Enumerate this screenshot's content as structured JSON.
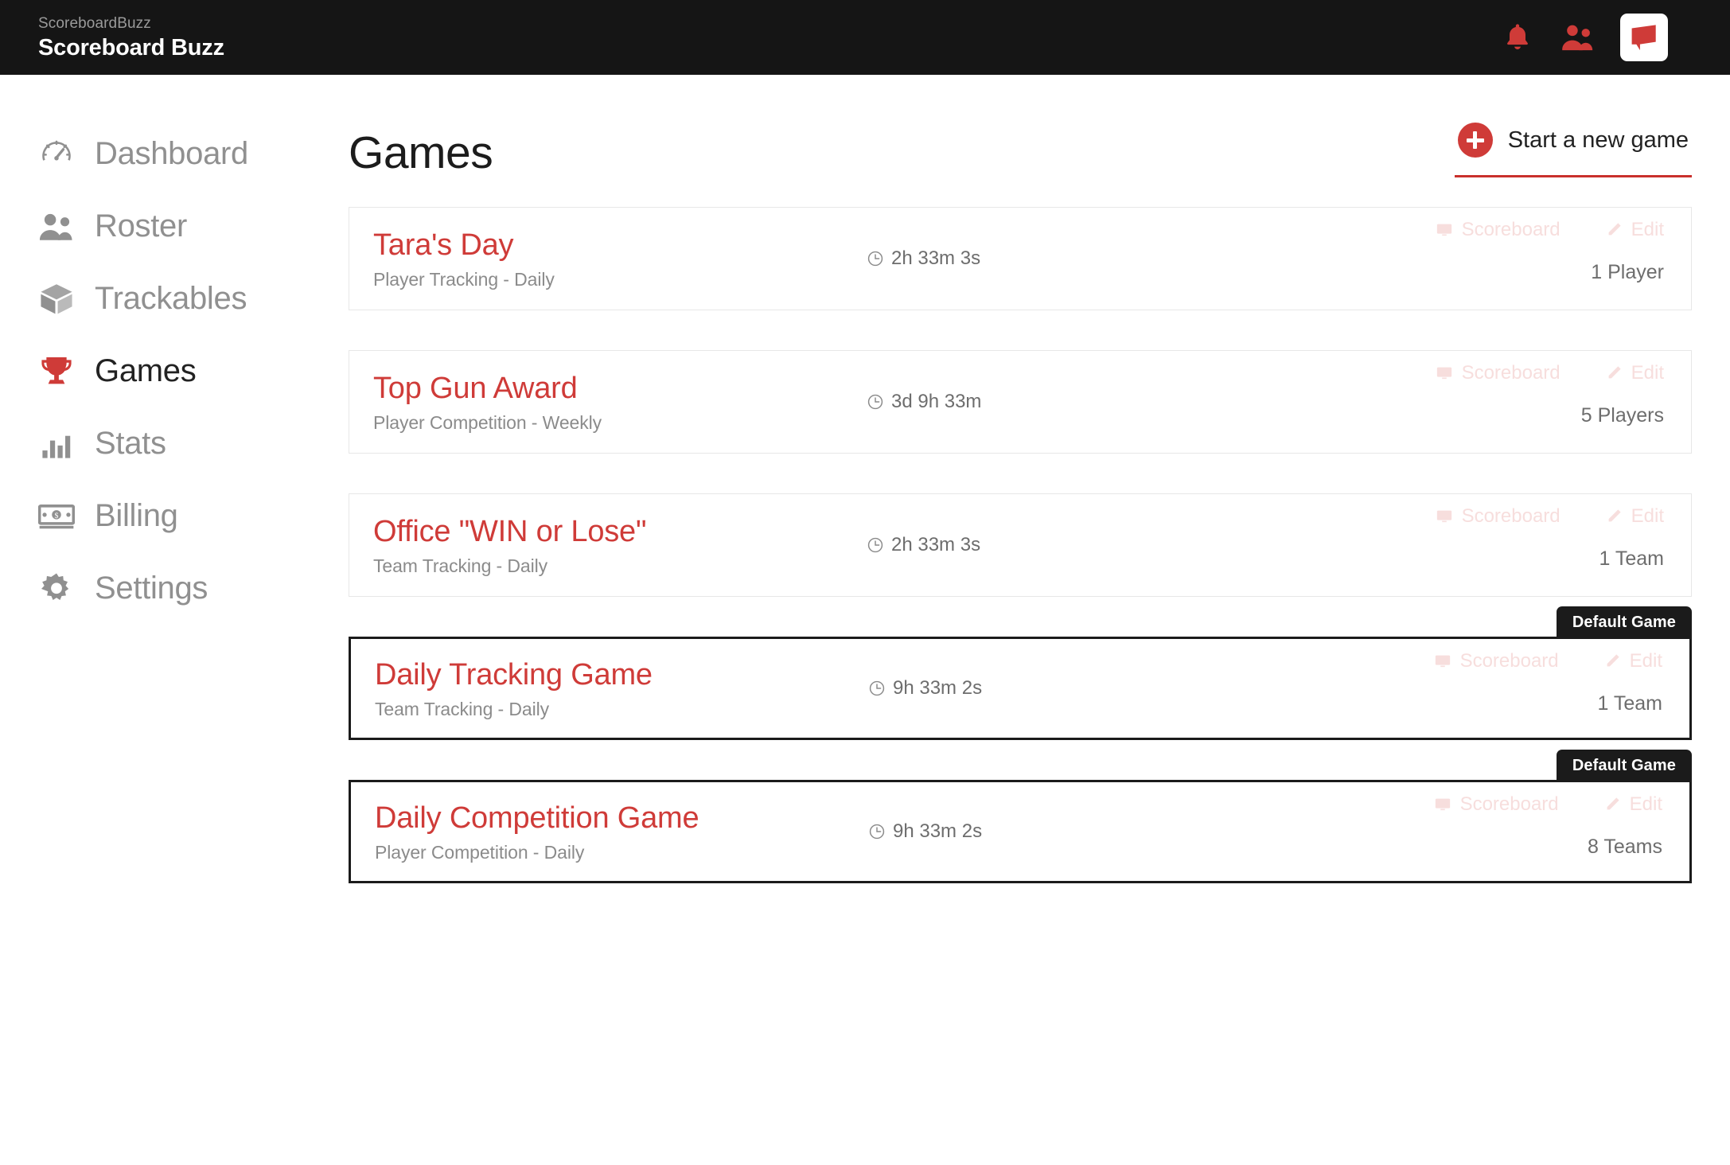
{
  "topbar": {
    "brand_sub": "ScoreboardBuzz",
    "brand_title": "Scoreboard Buzz",
    "icons": [
      "bell-icon",
      "users-icon",
      "app-logo-icon"
    ]
  },
  "sidebar": {
    "items": [
      {
        "label": "Dashboard",
        "icon": "speedometer-icon",
        "active": false
      },
      {
        "label": "Roster",
        "icon": "users-icon",
        "active": false
      },
      {
        "label": "Trackables",
        "icon": "box-icon",
        "active": false
      },
      {
        "label": "Games",
        "icon": "trophy-icon",
        "active": true
      },
      {
        "label": "Stats",
        "icon": "bar-chart-icon",
        "active": false
      },
      {
        "label": "Billing",
        "icon": "money-bill-icon",
        "active": false
      },
      {
        "label": "Settings",
        "icon": "gear-icon",
        "active": false
      }
    ]
  },
  "main": {
    "page_title": "Games",
    "new_game_label": "Start a new game",
    "default_badge_label": "Default Game",
    "scoreboard_label": "Scoreboard",
    "edit_label": "Edit",
    "games": [
      {
        "name": "Tara's Day",
        "subtitle": "Player Tracking - Daily",
        "duration": "2h 33m 3s",
        "count": "1 Player",
        "is_default": false
      },
      {
        "name": "Top Gun Award",
        "subtitle": "Player Competition - Weekly",
        "duration": "3d 9h 33m",
        "count": "5 Players",
        "is_default": false
      },
      {
        "name": "Office \"WIN or Lose\"",
        "subtitle": "Team Tracking - Daily",
        "duration": "2h 33m 3s",
        "count": "1 Team",
        "is_default": false
      },
      {
        "name": "Daily Tracking Game",
        "subtitle": "Team Tracking - Daily",
        "duration": "9h 33m 2s",
        "count": "1 Team",
        "is_default": true
      },
      {
        "name": "Daily Competition Game",
        "subtitle": "Player Competition - Daily",
        "duration": "9h 33m 2s",
        "count": "8 Teams",
        "is_default": true
      }
    ]
  },
  "colors": {
    "brand_red": "#cf3b38",
    "topbar_black": "#151515",
    "muted_gray": "#909090",
    "faded_pink": "#f7dedd"
  }
}
